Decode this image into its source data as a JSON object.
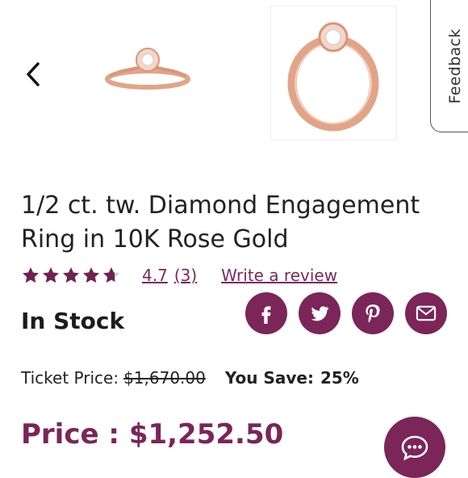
{
  "feedback": {
    "label": "Feedback"
  },
  "product": {
    "title": "1/2 ct. tw. Diamond Engagement Ring in 10K Rose Gold",
    "rating": {
      "value": "4.7",
      "count": "(3)",
      "stars": 4.7,
      "write_review": "Write a review"
    },
    "stock": "In Stock",
    "ticket_label": "Ticket Price:",
    "ticket_price": "$1,670.00",
    "you_save_label": "You Save:",
    "you_save_value": "25%",
    "price": "Price : $1,252.50"
  },
  "colors": {
    "brand": "#7b2558",
    "star": "#6e2250",
    "ring": "#e3a78c"
  },
  "icons": [
    "back-chevron-icon",
    "facebook-icon",
    "twitter-icon",
    "pinterest-icon",
    "email-icon",
    "chat-icon"
  ]
}
